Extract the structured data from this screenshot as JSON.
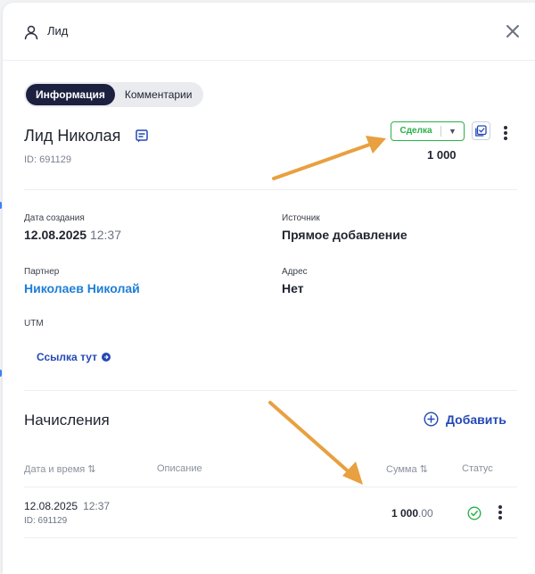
{
  "header": {
    "title": "Лид",
    "icon": "user-icon",
    "close_icon": "close-icon"
  },
  "tabs": [
    {
      "label": "Информация",
      "active": true
    },
    {
      "label": "Комментарии",
      "active": false
    }
  ],
  "lead": {
    "name": "Лид Николая",
    "id_text": "ID: 691129",
    "deal_button": {
      "label": "Сделка",
      "dropdown_icon": "chevron-down-icon",
      "color": "#2bb04a"
    },
    "deal_amount": "1 000"
  },
  "fields": {
    "created": {
      "label": "Дата создания",
      "date": "12.08.2025",
      "time": "12:37"
    },
    "source": {
      "label": "Источник",
      "value": "Прямое добавление"
    },
    "partner": {
      "label": "Партнер",
      "value": "Николаев Николай"
    },
    "address": {
      "label": "Адрес",
      "value": "Нет"
    },
    "utm": {
      "label": "UTM",
      "link": "Ссылка тут"
    }
  },
  "accruals": {
    "title": "Начисления",
    "add_label": "Добавить",
    "columns": [
      "Дата и время",
      "Описание",
      "Сумма",
      "Статус"
    ],
    "rows": [
      {
        "date": "12.08.2025",
        "time": "12:37",
        "id": "ID: 691129",
        "description": "",
        "sum_int": "1 000",
        "sum_dec": ".00",
        "status": "check-circle-icon"
      }
    ]
  },
  "colors": {
    "accent": "#2348b6",
    "link": "#1e7ed6",
    "tab_active": "#1d2140",
    "success": "#2bb04a",
    "arrow": "#e8a040"
  }
}
